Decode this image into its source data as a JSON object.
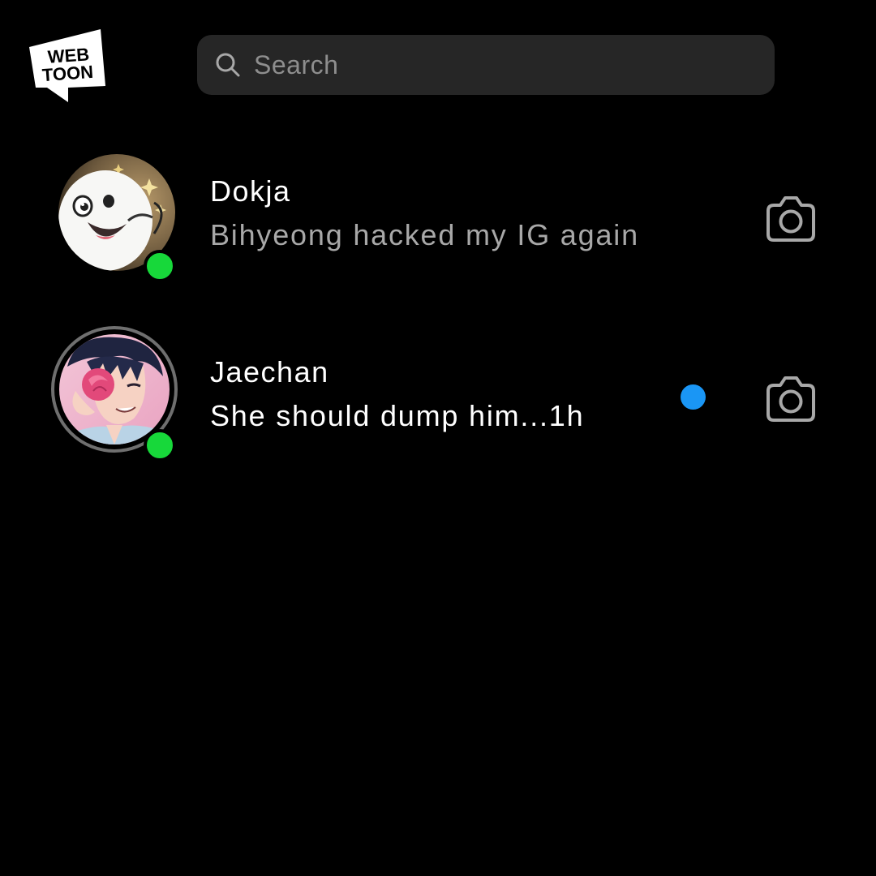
{
  "brand": {
    "logo_line1": "WEB",
    "logo_line2": "TOON",
    "logo_icon": "webtoon-logo"
  },
  "search": {
    "placeholder": "Search",
    "value": "",
    "icon": "search-icon"
  },
  "conversations": [
    {
      "name": "Dokja",
      "preview": "Bihyeong hacked my IG again",
      "online": true,
      "unread": false,
      "avatar_has_story_ring": false,
      "action_icon": "camera-icon"
    },
    {
      "name": "Jaechan",
      "preview": "She should dump him...1h",
      "online": true,
      "unread": true,
      "avatar_has_story_ring": true,
      "action_icon": "camera-icon"
    }
  ],
  "colors": {
    "background": "#000000",
    "search_bg": "#262626",
    "online": "#17d83a",
    "unread": "#1a96f5",
    "muted_text": "#a8a8a8"
  }
}
